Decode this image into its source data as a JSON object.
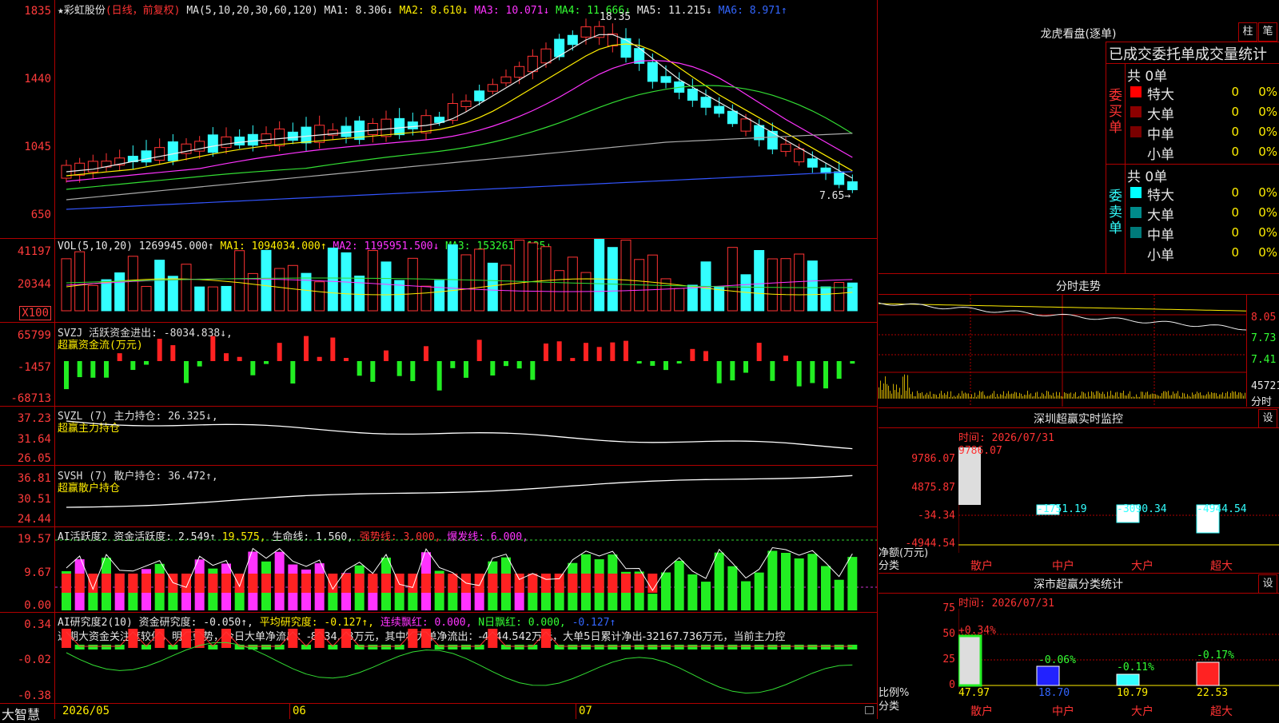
{
  "stock": {
    "name": "★彩虹股份",
    "mode": "(日线，前复权)"
  },
  "ma_line": {
    "label": "MA(5,10,20,30,60,120)",
    "ma1": "MA1: 8.306↓",
    "ma2": "MA2: 8.610↓",
    "ma3": "MA3: 10.071↓",
    "ma4": "MA4: 11.666↓",
    "ma5": "MA5: 11.215↓",
    "ma6": "MA6: 8.971↑"
  },
  "price_axis": [
    "1835",
    "1440",
    "1045",
    "650"
  ],
  "price_annotations": {
    "high": "18.35",
    "low": "7.65→"
  },
  "vol": {
    "title": "VOL(5,10,20)",
    "value": "1269945.000↑",
    "ma1": "MA1: 1094034.000↑",
    "ma2": "MA2: 1195951.500↓",
    "ma3": "MA3: 1532616.125↓",
    "axis": [
      "41197",
      "20344",
      "X100"
    ]
  },
  "svzj": {
    "title": "SVZJ  活跃资金进出: -8034.838↓,",
    "subtitle": "超赢资金流(万元)",
    "axis": [
      "65799",
      "-1457",
      "-68713"
    ]
  },
  "svzl": {
    "title": "SVZL (7) 主力持仓: 26.325↓,",
    "subtitle": "超赢主力持仓",
    "axis": [
      "37.23",
      "31.64",
      "26.05"
    ]
  },
  "svsh": {
    "title": "SVSH (7) 散户持仓: 36.472↑,",
    "subtitle": "超赢散户持仓",
    "axis": [
      "36.81",
      "30.51",
      "24.44"
    ]
  },
  "ai_active": {
    "title": "AI活跃度2 资金活跃度: 2.549↑",
    "v2": "19.575,",
    "life": "生命线: 1.560,",
    "strong": "强势线: 3.000,",
    "burst": "爆发线: 6.000,",
    "axis": [
      "19.57",
      "9.67",
      "0.00"
    ]
  },
  "ai_research": {
    "title": "AI研究度2(10) 资金研究度: -0.050↑,",
    "avg": "平均研究度: -0.127↑,",
    "cont": "连续飘红: 0.000,",
    "nday": "N日飘红: 0.000,",
    "last": "-0.127↑",
    "commentary": "近期大资金关注度较低，明显弱势，今日大单净流出：-8034.88万元，其中特大单净流出：-4944.542万元，大单5日累计净出-32167.736万元，当前主力控",
    "axis": [
      "0.34",
      "-0.02",
      "-0.38"
    ]
  },
  "footer": {
    "brand": "大智慧",
    "dates": [
      "2026/05",
      "06",
      "07"
    ]
  },
  "longhu": {
    "title": "龙虎看盘(逐单)",
    "btn1": "柱",
    "btn2": "笔",
    "header": "已成交委托单成交量统计",
    "buy_label": "委买单",
    "sell_label": "委卖单",
    "buy_total": "共 0单",
    "sell_total": "共 0单",
    "rows": [
      {
        "name": "特大",
        "count": "0",
        "pct": "0%"
      },
      {
        "name": "大单",
        "count": "0",
        "pct": "0%"
      },
      {
        "name": "中单",
        "count": "0",
        "pct": "0%"
      },
      {
        "name": "小单",
        "count": "0",
        "pct": "0%"
      }
    ],
    "colors_buy": [
      "#ff0000",
      "#8b0000",
      "#7a0000",
      "#000000"
    ],
    "colors_sell": [
      "#00ffff",
      "#008b8b",
      "#007a7a",
      "#000000"
    ]
  },
  "fenshi": {
    "title": "分时走势",
    "axis": [
      "8.05",
      "7.73",
      "7.41"
    ],
    "vol": "45721",
    "vol_label": "分时"
  },
  "sz_monitor": {
    "title": "深圳超赢实时监控",
    "btn": "设",
    "time": "时间: 2026/07/31",
    "axis": [
      "9786.07",
      "4875.87",
      "-34.34",
      "-4944.54"
    ],
    "ylabel": "净额(万元)",
    "xlabel": "分类",
    "values": [
      "9786.07",
      "-1751.19",
      "-3090.34",
      "-4944.54"
    ],
    "cats": [
      "散户",
      "中户",
      "大户",
      "超大"
    ]
  },
  "sz_class": {
    "title": "深市超赢分类统计",
    "btn": "设",
    "time": "时间: 2026/07/31",
    "axis": [
      "75",
      "50",
      "25",
      "0"
    ],
    "ylabel": "比例%",
    "xlabel": "分类",
    "pct_labels": [
      "+0.34%",
      "-0.06%",
      "-0.11%",
      "-0.17%"
    ],
    "values": [
      "47.97",
      "18.70",
      "10.79",
      "22.53"
    ],
    "cats": [
      "散户",
      "中户",
      "大户",
      "超大"
    ]
  }
}
